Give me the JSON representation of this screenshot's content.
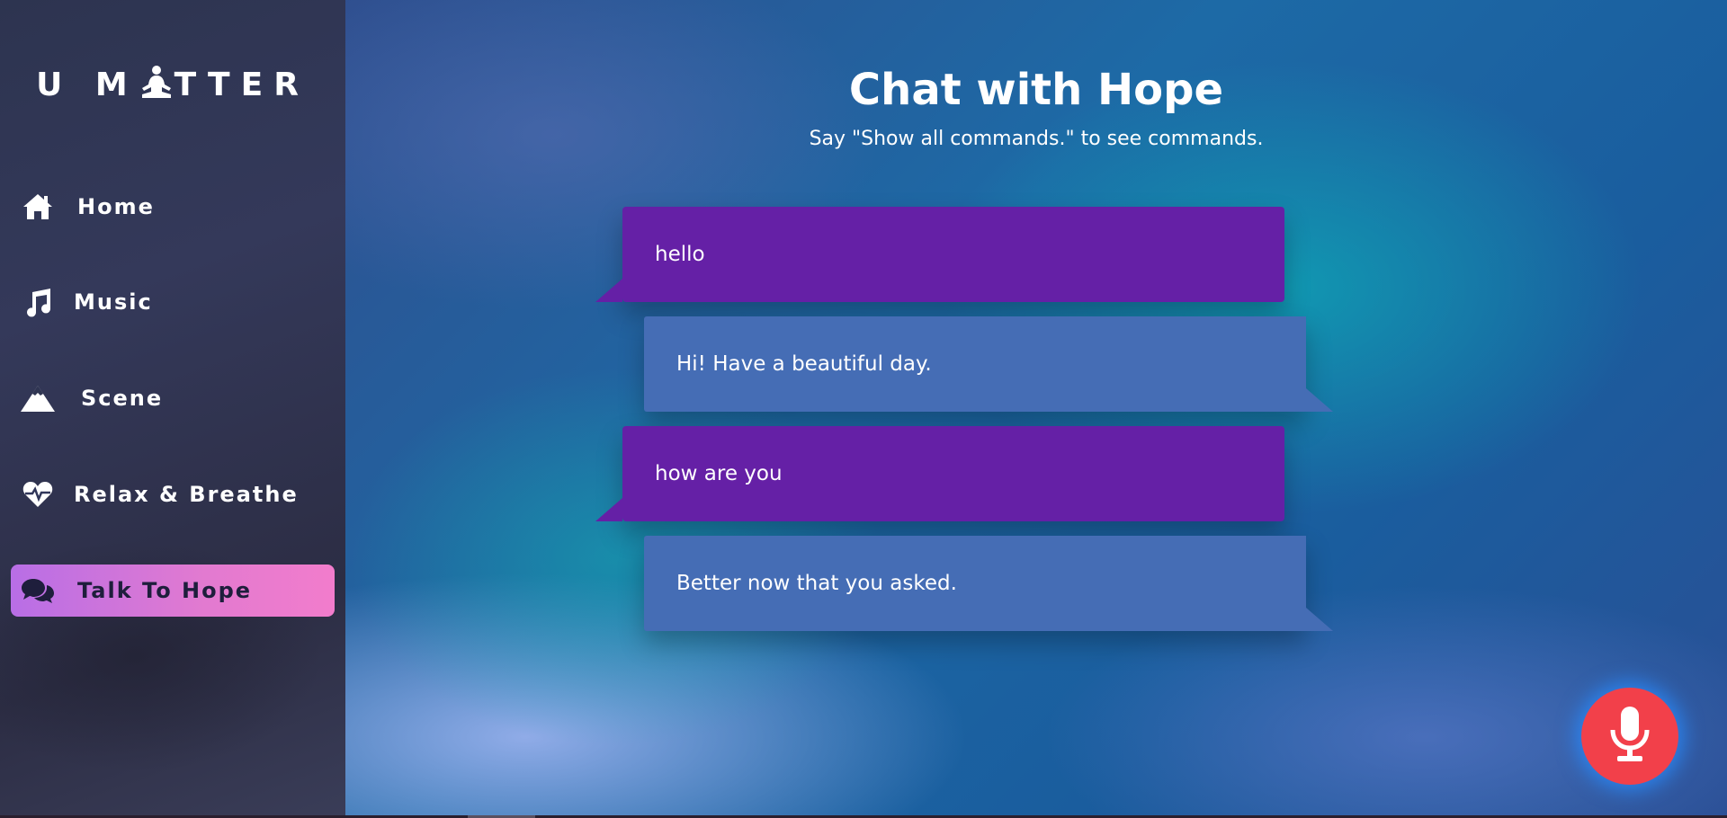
{
  "brand": {
    "text_before": "U M",
    "text_after": "TTER",
    "icon": "meditation-icon"
  },
  "sidebar": {
    "items": [
      {
        "label": "Home",
        "icon": "home-icon"
      },
      {
        "label": "Music",
        "icon": "music-note-icon"
      },
      {
        "label": "Scene",
        "icon": "mountain-icon"
      },
      {
        "label": "Relax & Breathe",
        "icon": "heartbeat-icon"
      },
      {
        "label": "Talk To Hope",
        "icon": "chat-bubbles-icon",
        "active": true
      }
    ]
  },
  "main": {
    "title": "Chat with Hope",
    "subtitle": "Say \"Show all commands.\" to see commands.",
    "messages": [
      {
        "sender": "user",
        "text": "hello"
      },
      {
        "sender": "bot",
        "text": "Hi! Have a beautiful day."
      },
      {
        "sender": "user",
        "text": "how are you"
      },
      {
        "sender": "bot",
        "text": "Better now that you asked."
      }
    ]
  },
  "mic_button": {
    "icon": "microphone-icon"
  },
  "colors": {
    "active_nav_gradient": [
      "#b86ee6",
      "#f27ccc"
    ],
    "user_bubble": "#6520a6",
    "bot_bubble": "#456db5",
    "mic_button": "#f2404a"
  }
}
